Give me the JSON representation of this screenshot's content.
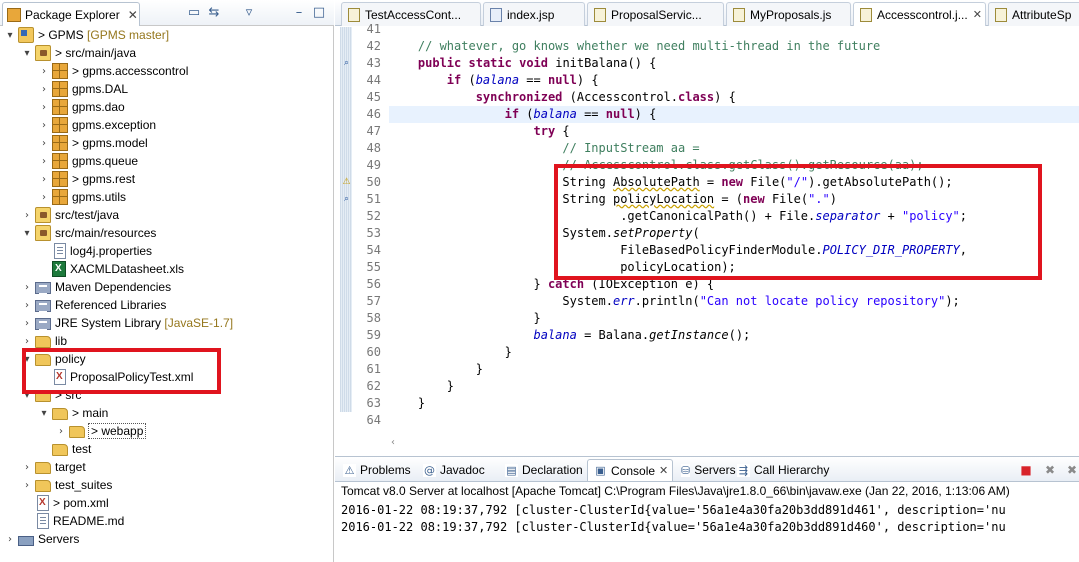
{
  "explorer": {
    "tab_label": "Package Explorer",
    "tab_close": "✕",
    "header_buttons": [
      "▭",
      "⇆",
      "▿",
      "–",
      "□"
    ],
    "items": [
      {
        "label": "GPMS",
        "prefix": "> ",
        "decoration": " [GPMS master]",
        "twisty": "▾",
        "icon": "project-icon",
        "indent": 0
      },
      {
        "label": "src/main/java",
        "prefix": "> ",
        "decoration": "",
        "twisty": "▾",
        "icon": "source-folder-icon",
        "indent": 1
      },
      {
        "label": "gpms.accesscontrol",
        "prefix": "> ",
        "decoration": "",
        "twisty": "›",
        "icon": "package-icon",
        "indent": 2
      },
      {
        "label": "gpms.DAL",
        "prefix": "",
        "decoration": "",
        "twisty": "›",
        "icon": "package-icon",
        "indent": 2
      },
      {
        "label": "gpms.dao",
        "prefix": "",
        "decoration": "",
        "twisty": "›",
        "icon": "package-icon",
        "indent": 2
      },
      {
        "label": "gpms.exception",
        "prefix": "",
        "decoration": "",
        "twisty": "›",
        "icon": "package-icon",
        "indent": 2
      },
      {
        "label": "gpms.model",
        "prefix": "> ",
        "decoration": "",
        "twisty": "›",
        "icon": "package-icon",
        "indent": 2
      },
      {
        "label": "gpms.queue",
        "prefix": "",
        "decoration": "",
        "twisty": "›",
        "icon": "package-icon",
        "indent": 2
      },
      {
        "label": "gpms.rest",
        "prefix": "> ",
        "decoration": "",
        "twisty": "›",
        "icon": "package-icon",
        "indent": 2
      },
      {
        "label": "gpms.utils",
        "prefix": "",
        "decoration": "",
        "twisty": "›",
        "icon": "package-icon",
        "indent": 2
      },
      {
        "label": "src/test/java",
        "prefix": "",
        "decoration": "",
        "twisty": "›",
        "icon": "source-folder-icon",
        "indent": 1
      },
      {
        "label": "src/main/resources",
        "prefix": "",
        "decoration": "",
        "twisty": "▾",
        "icon": "source-folder-icon",
        "indent": 1
      },
      {
        "label": "log4j.properties",
        "prefix": "",
        "decoration": "",
        "twisty": "",
        "icon": "file-icon",
        "indent": 2
      },
      {
        "label": "XACMLDatasheet.xls",
        "prefix": "",
        "decoration": "",
        "twisty": "",
        "icon": "excel-file-icon",
        "indent": 2
      },
      {
        "label": "Maven Dependencies",
        "prefix": "",
        "decoration": "",
        "twisty": "›",
        "icon": "library-icon",
        "indent": 1
      },
      {
        "label": "Referenced Libraries",
        "prefix": "",
        "decoration": "",
        "twisty": "›",
        "icon": "library-icon",
        "indent": 1
      },
      {
        "label": "JRE System Library",
        "prefix": "",
        "decoration": " [JavaSE-1.7]",
        "twisty": "›",
        "icon": "library-icon",
        "indent": 1
      },
      {
        "label": "lib",
        "prefix": "",
        "decoration": "",
        "twisty": "›",
        "icon": "folder-icon",
        "indent": 1
      },
      {
        "label": "policy",
        "prefix": "",
        "decoration": "",
        "twisty": "▾",
        "icon": "folder-icon",
        "indent": 1
      },
      {
        "label": "ProposalPolicyTest.xml",
        "prefix": "",
        "decoration": "",
        "twisty": "",
        "icon": "xml-file-icon",
        "indent": 2
      },
      {
        "label": "src",
        "prefix": "> ",
        "decoration": "",
        "twisty": "▾",
        "icon": "folder-icon",
        "indent": 1
      },
      {
        "label": "main",
        "prefix": "> ",
        "decoration": "",
        "twisty": "▾",
        "icon": "folder-icon",
        "indent": 2
      },
      {
        "label": "webapp",
        "prefix": "> ",
        "decoration": "",
        "twisty": "›",
        "icon": "folder-icon",
        "indent": 3
      },
      {
        "label": "test",
        "prefix": "",
        "decoration": "",
        "twisty": "",
        "icon": "folder-icon",
        "indent": 2
      },
      {
        "label": "target",
        "prefix": "",
        "decoration": "",
        "twisty": "›",
        "icon": "folder-icon",
        "indent": 1
      },
      {
        "label": "test_suites",
        "prefix": "",
        "decoration": "",
        "twisty": "›",
        "icon": "folder-icon",
        "indent": 1
      },
      {
        "label": "pom.xml",
        "prefix": "> ",
        "decoration": "",
        "twisty": "",
        "icon": "xml-file-icon",
        "indent": 1
      },
      {
        "label": "README.md",
        "prefix": "",
        "decoration": "",
        "twisty": "",
        "icon": "file-icon",
        "indent": 1
      },
      {
        "label": "Servers",
        "prefix": "",
        "decoration": "",
        "twisty": "›",
        "icon": "server-folder-icon",
        "indent": 0
      }
    ]
  },
  "editor": {
    "tabs": [
      {
        "label": "TestAccessCont...",
        "icon": "java",
        "active": false
      },
      {
        "label": "index.jsp",
        "icon": "jsp",
        "active": false
      },
      {
        "label": "ProposalServic...",
        "icon": "java",
        "active": false
      },
      {
        "label": "MyProposals.js",
        "icon": "js",
        "active": false
      },
      {
        "label": "Accesscontrol.j...",
        "icon": "java",
        "active": true
      },
      {
        "label": "AttributeSp",
        "icon": "java",
        "active": false
      }
    ],
    "tab_close": "✕",
    "line_numbers": [
      "41",
      "42",
      "43",
      "44",
      "45",
      "46",
      "47",
      "48",
      "49",
      "50",
      "51",
      "52",
      "53",
      "54",
      "55",
      "56",
      "57",
      "58",
      "59",
      "60",
      "61",
      "62",
      "63",
      "64"
    ],
    "code_lines": [
      [],
      [
        {
          "t": "    "
        },
        {
          "t": "// whatever, go knows whether we need multi-thread in the future",
          "c": "cm"
        }
      ],
      [
        {
          "t": "    "
        },
        {
          "t": "public",
          "c": "kw"
        },
        {
          "t": " "
        },
        {
          "t": "static",
          "c": "kw"
        },
        {
          "t": " "
        },
        {
          "t": "void",
          "c": "kw"
        },
        {
          "t": " initBalana() {"
        }
      ],
      [
        {
          "t": "        "
        },
        {
          "t": "if",
          "c": "kw"
        },
        {
          "t": " ("
        },
        {
          "t": "balana",
          "c": "fld"
        },
        {
          "t": " == "
        },
        {
          "t": "null",
          "c": "kw"
        },
        {
          "t": ") {"
        }
      ],
      [
        {
          "t": "            "
        },
        {
          "t": "synchronized",
          "c": "kw"
        },
        {
          "t": " (Accesscontrol."
        },
        {
          "t": "class",
          "c": "kw"
        },
        {
          "t": ") {"
        }
      ],
      [
        {
          "t": "                "
        },
        {
          "t": "if",
          "c": "kw"
        },
        {
          "t": " ("
        },
        {
          "t": "balana",
          "c": "fld"
        },
        {
          "t": " == "
        },
        {
          "t": "null",
          "c": "kw"
        },
        {
          "t": ") {"
        }
      ],
      [
        {
          "t": "                    "
        },
        {
          "t": "try",
          "c": "kw"
        },
        {
          "t": " {"
        }
      ],
      [
        {
          "t": "                        "
        },
        {
          "t": "// InputStream aa =",
          "c": "cm"
        }
      ],
      [
        {
          "t": "                        "
        },
        {
          "t": "// Accesscontrol.class.getClass().getResource(aa);",
          "c": "cm"
        }
      ],
      [
        {
          "t": "                        String "
        },
        {
          "t": "AbsolutePath",
          "c": "var ul"
        },
        {
          "t": " = "
        },
        {
          "t": "new",
          "c": "kw"
        },
        {
          "t": " File("
        },
        {
          "t": "\"/\"",
          "c": "st"
        },
        {
          "t": ").getAbsolutePath();"
        }
      ],
      [
        {
          "t": "                        String "
        },
        {
          "t": "policyLocation",
          "c": "var ul"
        },
        {
          "t": " = ("
        },
        {
          "t": "new",
          "c": "kw"
        },
        {
          "t": " File("
        },
        {
          "t": "\".\"",
          "c": "st"
        },
        {
          "t": ")"
        }
      ],
      [
        {
          "t": "                                .getCanonicalPath() + File."
        },
        {
          "t": "separator",
          "c": "fld"
        },
        {
          "t": " + "
        },
        {
          "t": "\"policy\"",
          "c": "st"
        },
        {
          "t": ";"
        }
      ],
      [
        {
          "t": "                        System."
        },
        {
          "t": "setProperty",
          "c": "sm"
        },
        {
          "t": "("
        }
      ],
      [
        {
          "t": "                                FileBasedPolicyFinderModule."
        },
        {
          "t": "POLICY_DIR_PROPERTY",
          "c": "fld"
        },
        {
          "t": ","
        }
      ],
      [
        {
          "t": "                                policyLocation);"
        }
      ],
      [
        {
          "t": "                    } "
        },
        {
          "t": "catch",
          "c": "kw"
        },
        {
          "t": " (IOException e) {"
        }
      ],
      [
        {
          "t": "                        System."
        },
        {
          "t": "err",
          "c": "fld"
        },
        {
          "t": ".println("
        },
        {
          "t": "\"Can not locate policy repository\"",
          "c": "st"
        },
        {
          "t": ");"
        }
      ],
      [
        {
          "t": "                    }"
        }
      ],
      [
        {
          "t": "                    "
        },
        {
          "t": "balana",
          "c": "fld"
        },
        {
          "t": " = Balana."
        },
        {
          "t": "getInstance",
          "c": "sm"
        },
        {
          "t": "();"
        }
      ],
      [
        {
          "t": "                }"
        }
      ],
      [
        {
          "t": "            }"
        }
      ],
      [
        {
          "t": "        }"
        }
      ],
      [
        {
          "t": "    }"
        }
      ],
      []
    ],
    "scroll_arrow": "‹"
  },
  "console": {
    "tabs": [
      {
        "label": "Problems",
        "icon": "problems-icon",
        "active": false
      },
      {
        "label": "Javadoc",
        "icon": "javadoc-icon",
        "active": false
      },
      {
        "label": "Declaration",
        "icon": "declaration-icon",
        "active": false
      },
      {
        "label": "Console",
        "icon": "console-icon",
        "active": true
      },
      {
        "label": "Servers",
        "icon": "servers-icon",
        "active": false
      },
      {
        "label": "Call Hierarchy",
        "icon": "call-hierarchy-icon",
        "active": false
      }
    ],
    "tab_close": "✕",
    "toolbar_buttons": [
      {
        "glyph": "■",
        "name": "terminate-icon",
        "color": "#d8232a"
      },
      {
        "glyph": "✖",
        "name": "remove-launch-icon",
        "color": "#8a8a8a"
      },
      {
        "glyph": "✖",
        "name": "remove-all-icon",
        "color": "#8a8a8a"
      }
    ],
    "header": "Tomcat v8.0 Server at localhost [Apache Tomcat] C:\\Program Files\\Java\\jre1.8.0_66\\bin\\javaw.exe (Jan 22, 2016, 1:13:06 AM)",
    "lines": [
      "2016-01-22 08:19:37,792 [cluster-ClusterId{value='56a1e4a30fa20b3dd891d461', description='nu",
      "2016-01-22 08:19:37,792 [cluster-ClusterId{value='56a1e4a30fa20b3dd891d460', description='nu"
    ]
  },
  "colors": {
    "highlight_box": "#e0141e",
    "keyword": "#7f0055",
    "comment": "#3f7f5f",
    "string": "#2a00ff",
    "field": "#0000c0",
    "current_line": "#e8f2fe"
  }
}
